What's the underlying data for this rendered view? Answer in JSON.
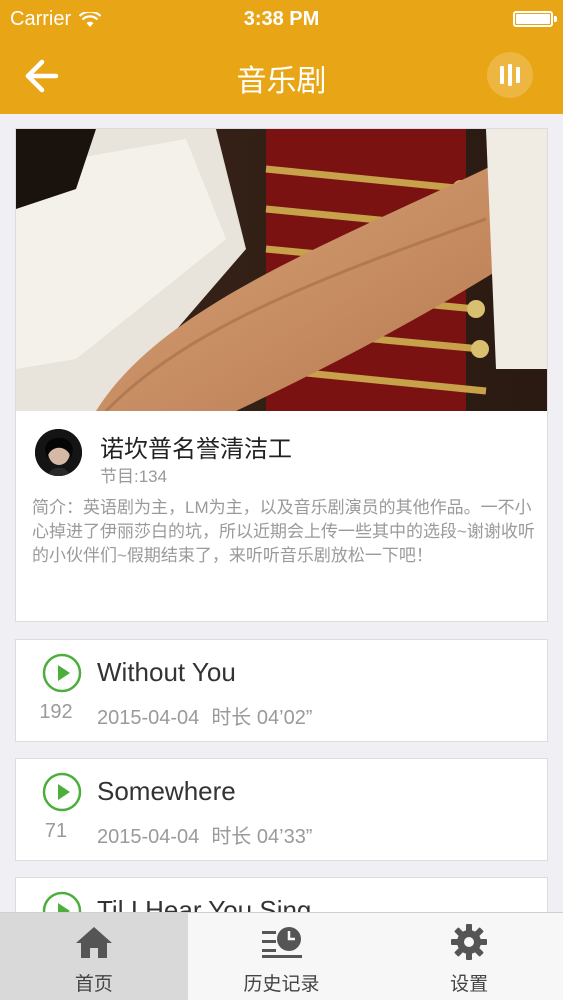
{
  "status_bar": {
    "carrier": "Carrier",
    "time": "3:38 PM"
  },
  "nav": {
    "title": "音乐剧"
  },
  "album": {
    "name": "诺坎普名誉清洁工",
    "track_count": "节目:134",
    "intro": "简介：英语剧为主，LM为主，以及音乐剧演员的其他作品。一不小心掉进了伊丽莎白的坑，所以近期会上传一些其中的选段~谢谢收听的小伙伴们~假期结束了，来听听音乐剧放松一下吧！"
  },
  "tracks": [
    {
      "title": "Without You",
      "plays": "192",
      "date": "2015-04-04",
      "duration_label": "时长",
      "duration": "04’02”"
    },
    {
      "title": "Somewhere",
      "plays": "71",
      "date": "2015-04-04",
      "duration_label": "时长",
      "duration": "04’33”"
    },
    {
      "title": "Til I Hear You Sing"
    }
  ],
  "tabs": [
    {
      "label": "首页",
      "icon": "home-icon",
      "active": true
    },
    {
      "label": "历史记录",
      "icon": "history-icon",
      "active": false
    },
    {
      "label": "设置",
      "icon": "gear-icon",
      "active": false
    }
  ],
  "colors": {
    "accent": "#e8a617",
    "play_green": "#4caf3c"
  }
}
